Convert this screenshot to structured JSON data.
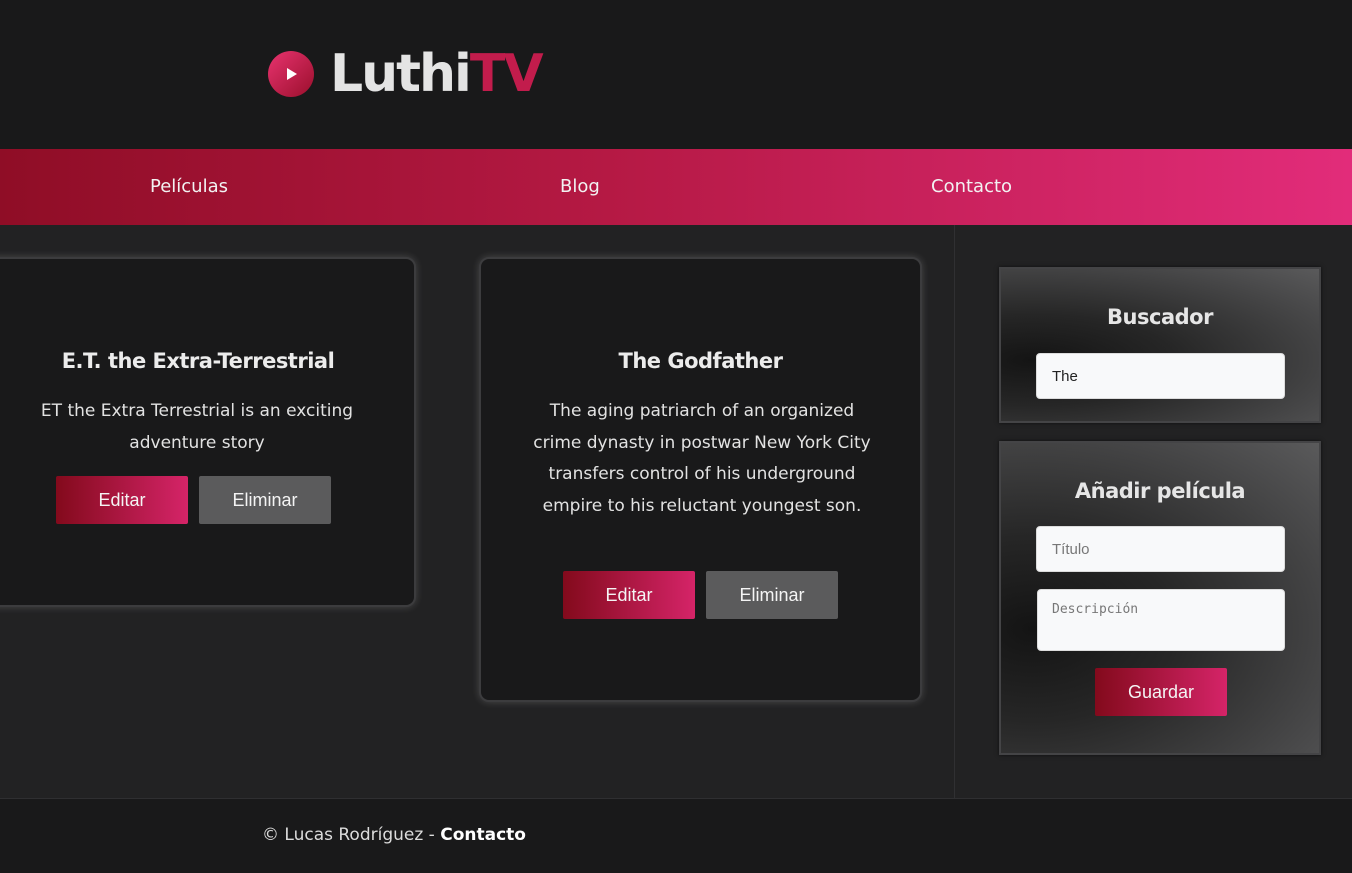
{
  "brand": {
    "name_part1": "Luthi",
    "name_part2": "TV",
    "accent_color": "#c21c4c",
    "icon": "play-icon"
  },
  "nav": {
    "items": [
      {
        "label": "Películas"
      },
      {
        "label": "Blog"
      },
      {
        "label": "Contacto"
      }
    ]
  },
  "movies": [
    {
      "title": "E.T. the Extra-Terrestrial",
      "description": "ET the Extra Terrestrial is an exciting adventure story",
      "edit_label": "Editar",
      "delete_label": "Eliminar"
    },
    {
      "title": "The Godfather",
      "description": "The aging patriarch of an organized crime dynasty in postwar New York City transfers control of his underground empire to his reluctant youngest son.",
      "edit_label": "Editar",
      "delete_label": "Eliminar"
    }
  ],
  "search": {
    "title": "Buscador",
    "value": "The"
  },
  "add_movie": {
    "title": "Añadir película",
    "title_placeholder": "Título",
    "description_placeholder": "Descripción",
    "save_label": "Guardar"
  },
  "footer": {
    "copyright": "© Lucas Rodríguez - ",
    "link_label": "Contacto"
  }
}
